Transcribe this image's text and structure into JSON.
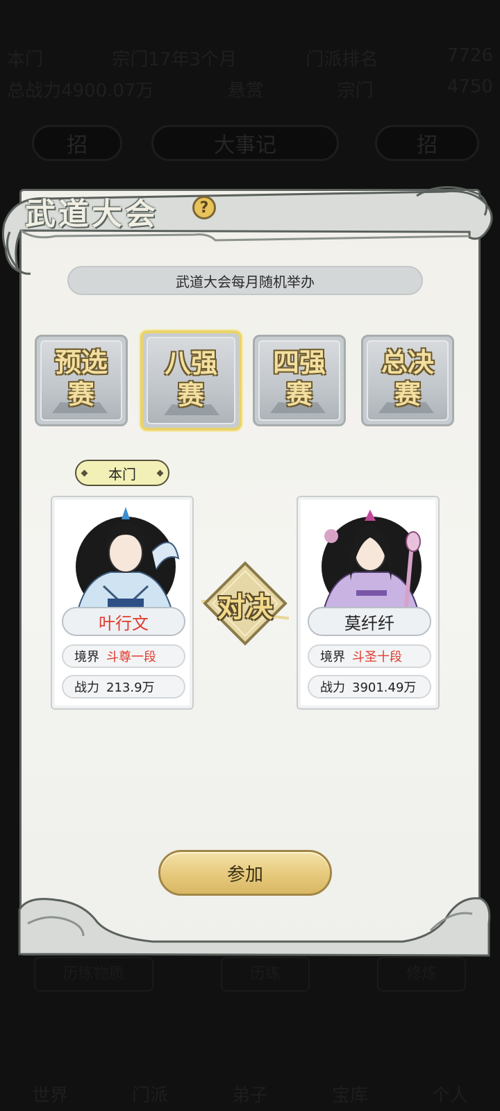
{
  "background": {
    "topbar_row1": [
      "本门",
      "宗门17年3个月",
      "门派排名",
      "7726"
    ],
    "topbar_row2": [
      "总战力4900.07万",
      "悬赏",
      "宗门",
      "4750"
    ],
    "title_pill": "大事记",
    "left_pill": "招",
    "right_pill": "招",
    "mid_row": [
      "历练物质",
      "历练",
      "修炼"
    ],
    "nav": [
      "世界",
      "门派",
      "弟子",
      "宝库",
      "个人"
    ]
  },
  "modal": {
    "title": "武道大会",
    "help_icon_glyph": "?",
    "notice": "武道大会每月随机举办",
    "tabs": [
      {
        "line1": "预选",
        "line2": "赛",
        "active": false
      },
      {
        "line1": "八强",
        "line2": "赛",
        "active": true
      },
      {
        "line1": "四强",
        "line2": "赛",
        "active": false
      },
      {
        "line1": "总决",
        "line2": "赛",
        "active": false
      }
    ],
    "sect_tag": "本门",
    "vs_label": "对决",
    "left_fighter": {
      "name": "叶行文",
      "realm_label": "境界",
      "realm": "斗尊一段",
      "power_label": "战力",
      "power": "213.9万"
    },
    "right_fighter": {
      "name": "莫纤纤",
      "realm_label": "境界",
      "realm": "斗圣十段",
      "power_label": "战力",
      "power": "3901.49万"
    },
    "join_button": "参加"
  },
  "colors": {
    "accent_gold": "#e6c97b",
    "highlight_red": "#e03a2c",
    "active_tab_border": "#e9d36a"
  }
}
